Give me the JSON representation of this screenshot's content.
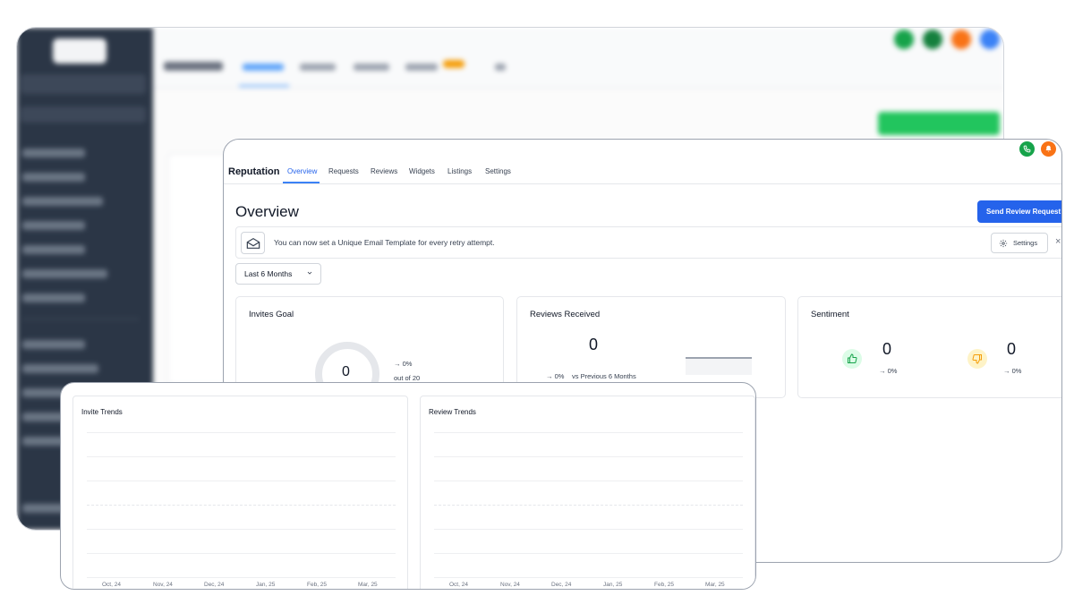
{
  "app": {
    "section_title": "Reputation",
    "tabs": [
      {
        "label": "Overview",
        "active": true
      },
      {
        "label": "Requests",
        "active": false
      },
      {
        "label": "Reviews",
        "active": false
      },
      {
        "label": "Widgets",
        "active": false
      },
      {
        "label": "Listings",
        "active": false
      },
      {
        "label": "Settings",
        "active": false
      }
    ],
    "header_icons": [
      "phone-icon",
      "bell-icon"
    ]
  },
  "overview": {
    "title": "Overview",
    "send_button_label": "Send Review Request"
  },
  "banner": {
    "icon": "envelope-icon",
    "text": "You can now set a Unique Email Template for every retry attempt.",
    "settings_label": "Settings",
    "close_glyph": "×"
  },
  "filter": {
    "range_label": "Last 6 Months"
  },
  "cards": {
    "invites_goal": {
      "title": "Invites Goal",
      "value": "0",
      "change": "→ 0%",
      "goal_text": "out of 20"
    },
    "reviews_received": {
      "title": "Reviews Received",
      "value": "0",
      "change": "→ 0%",
      "comparison": "vs Previous 6 Months"
    },
    "sentiment": {
      "title": "Sentiment",
      "positive": {
        "value": "0",
        "change": "→ 0%",
        "icon": "thumbs-up-icon"
      },
      "negative": {
        "value": "0",
        "change": "→ 0%",
        "icon": "thumbs-down-icon"
      }
    }
  },
  "trends": {
    "invite_trends": {
      "title": "Invite Trends",
      "x_labels": [
        "Oct, 24",
        "Nov, 24",
        "Dec, 24",
        "Jan, 25",
        "Feb, 25",
        "Mar, 25"
      ]
    },
    "review_trends": {
      "title": "Review Trends",
      "x_labels": [
        "Oct, 24",
        "Nov, 24",
        "Dec, 24",
        "Jan, 25",
        "Feb, 25",
        "Mar, 25"
      ]
    }
  },
  "colors": {
    "primary": "#2563eb",
    "sidebar": "#2b3646",
    "positive": "#16a34a",
    "negative": "#f59e0b",
    "phone_badge": "#16a34a",
    "bell_badge": "#f97316"
  }
}
